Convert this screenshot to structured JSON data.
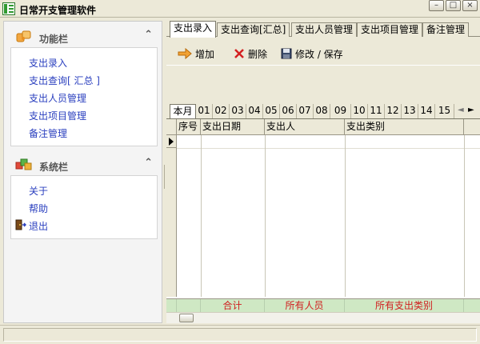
{
  "window": {
    "title": "日常开支管理软件",
    "buttons": {
      "minimize": "–",
      "maximize": "□",
      "close": "×"
    }
  },
  "sidebar": {
    "groups": [
      {
        "title": "功能栏",
        "icon": "puzzle-icon",
        "items": [
          {
            "label": "支出录入"
          },
          {
            "label": "支出查询[ 汇总 ]"
          },
          {
            "label": "支出人员管理"
          },
          {
            "label": "支出项目管理"
          },
          {
            "label": "备注管理"
          }
        ]
      },
      {
        "title": "系统栏",
        "icon": "blocks-icon",
        "items": [
          {
            "label": "关于"
          },
          {
            "label": "帮助"
          },
          {
            "label": "退出",
            "icon": "exit-door-icon"
          }
        ]
      }
    ]
  },
  "main": {
    "tabs": [
      {
        "label": "支出录入",
        "active": true
      },
      {
        "label": "支出查询[汇总]"
      },
      {
        "label": "支出人员管理"
      },
      {
        "label": "支出项目管理"
      },
      {
        "label": "备注管理"
      }
    ],
    "toolbar": {
      "add_label": "增加",
      "delete_label": "删除",
      "save_label": "修改 / 保存"
    },
    "months": [
      "本月",
      "01",
      "02",
      "03",
      "04",
      "05",
      "06",
      "07",
      "08",
      "09",
      "10",
      "11",
      "12",
      "13",
      "14",
      "15"
    ],
    "month_nav": {
      "prev": "◄",
      "next": "►"
    },
    "grid": {
      "columns": [
        "序号",
        "支出日期",
        "支出人",
        "支出类别",
        ""
      ],
      "footer": [
        "合计",
        "所有人员",
        "所有支出类别"
      ]
    }
  },
  "colors": {
    "link": "#2a3fbf",
    "footer_text": "#d02020",
    "footer_bg": "#cfe8c4",
    "chrome": "#ece9d8"
  }
}
